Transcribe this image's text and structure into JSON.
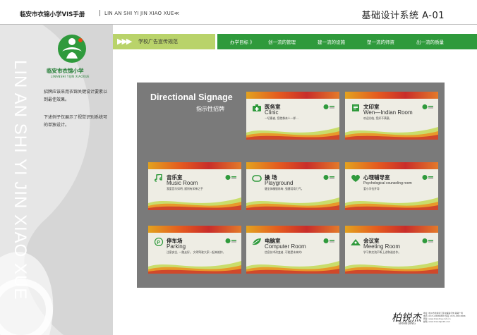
{
  "header": {
    "title": "临安市衣锦小学VIS手册",
    "separator": "|",
    "subtitle": "LIN AN SHI YI JIN XIAO XUE≪",
    "section_code": "基础设计系统 A-01"
  },
  "sidebar": {
    "vertical_text": "LIN AN SHI YI JIN XIAO XUE",
    "school_name": "临安市衣锦小学",
    "school_pinyin": "LINANSHI YIJIN XIAOXUE",
    "desc1": "招牌应该采用衣锦关键设计要素以到最佳效果。",
    "desc2": "下述例子仅展示了视觉识别系统可的单独设计。"
  },
  "nav": {
    "arrows": "▶▶▶",
    "current": "学校广告宣传规范",
    "items": [
      "办学目标 》",
      "创一流的管理",
      "建一流的设施",
      "塑一流的师资",
      "出一流的质量"
    ]
  },
  "panel": {
    "title": "Directional Signage",
    "subtitle": "指示性招牌"
  },
  "signs": [
    {
      "cn": "医务室",
      "en": "Clinic",
      "note": "一切患者, 您就像亲人一样...",
      "icon": "medical-kit-icon"
    },
    {
      "cn": "文印室",
      "en": "Wen—Indian Room",
      "note": "欢迎光临, 您好不满意。",
      "icon": "document-icon"
    },
    {
      "cn": "音乐室",
      "en": "Music Room",
      "note": "我爱音乐如明, 赋则有如神之手",
      "icon": "music-note-icon"
    },
    {
      "cn": "操  场",
      "en": "Playground",
      "note": "健全体魄锻炼每, 强健培育力气。",
      "icon": "playground-icon"
    },
    {
      "cn": "心理辅导室",
      "en": "Psychological counseling room",
      "note": "爱小学也开导",
      "icon": "heart-icon"
    },
    {
      "cn": "停车场",
      "en": "Parking",
      "note": "注意安全, 一路走好。 文明驾驶大家一起来维护。",
      "icon": "parking-icon"
    },
    {
      "cn": "电脑室",
      "en": "Computer Room",
      "note": "信息技术改变者, 可能是未来的!",
      "icon": "leaf-icon"
    },
    {
      "cn": "会议室",
      "en": "Meeting Room",
      "note": "学习和交流不断上进和谐合作。",
      "icon": "meeting-icon"
    }
  ],
  "footer": {
    "signature": "柏锐杰",
    "signature_sub": "BRANDING",
    "lines": [
      "地址: 杭州市钱塘新江区中策路与朱 路路广场",
      "电话: 0571-88888888 传真: 0571-888 8888",
      "网址: www.branding.com.cn",
      "邮箱: www.brand@126.com"
    ]
  },
  "colors": {
    "green_dark": "#2f9a3c",
    "green_light": "#b9d36a",
    "panel_gray": "#7a7a7a",
    "sidebar_gray": "#d6d6d6"
  }
}
